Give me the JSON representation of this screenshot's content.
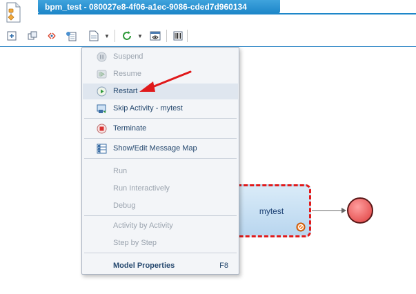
{
  "title_tab": {
    "label": "bpm_test - 080027e8-4f06-a1ec-9086-cded7d960134"
  },
  "toolbar": {
    "buttons": [
      "add-node-icon",
      "copy-icon",
      "link-icon",
      "properties-icon",
      "document-icon",
      "refresh-icon",
      "preview-icon",
      "barcode-icon"
    ]
  },
  "context_menu": {
    "suspend": "Suspend",
    "resume": "Resume",
    "restart": "Restart",
    "skip_activity": "Skip Activity - mytest",
    "terminate": "Terminate",
    "show_edit_message_map": "Show/Edit Message Map",
    "run": "Run",
    "run_interactively": "Run Interactively",
    "debug": "Debug",
    "activity_by_activity": "Activity by Activity",
    "step_by_step": "Step by Step",
    "model_properties": "Model Properties",
    "model_properties_shortcut": "F8"
  },
  "canvas": {
    "activity_label": "mytest"
  },
  "colors": {
    "accent": "#1e87c9",
    "highlight": "#dfe6ef",
    "error_dash": "#e21a1a",
    "end_event": "#e85a5a"
  }
}
